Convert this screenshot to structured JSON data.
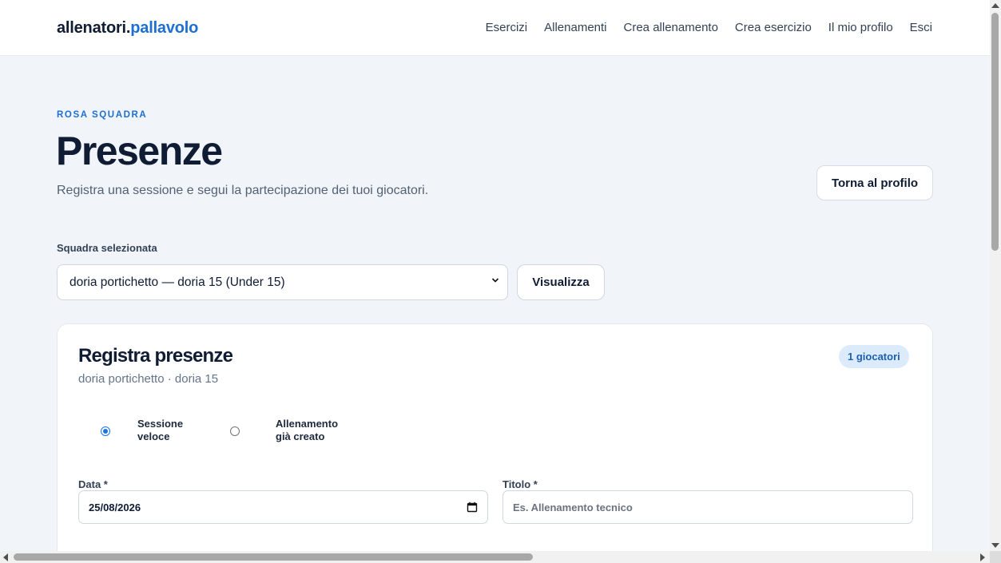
{
  "header": {
    "brand_part1": "allenatori.",
    "brand_part2": "pallavolo",
    "nav": [
      "Esercizi",
      "Allenamenti",
      "Crea allenamento",
      "Crea esercizio",
      "Il mio profilo",
      "Esci"
    ]
  },
  "hero": {
    "eyebrow": "ROSA SQUADRA",
    "title": "Presenze",
    "subtitle": "Registra una sessione e segui la partecipazione dei tuoi giocatori.",
    "back_button": "Torna al profilo"
  },
  "team": {
    "label": "Squadra selezionata",
    "selected": "doria portichetto — doria 15 (Under 15)",
    "view_button": "Visualizza"
  },
  "card": {
    "title": "Registra presenze",
    "subtitle": "doria portichetto · doria 15",
    "badge": "1 giocatori",
    "mode_options": [
      {
        "line1": "Sessione",
        "line2": "veloce",
        "checked": true
      },
      {
        "line1": "Allenamento",
        "line2": "già creato",
        "checked": false
      }
    ],
    "date_label": "Data *",
    "date_value": "25/08/2026",
    "title_label": "Titolo *",
    "title_placeholder": "Es. Allenamento tecnico"
  },
  "colors": {
    "accent": "#1d6fd1",
    "text_dark": "#0f1c33",
    "background": "#f1f5fa"
  },
  "icons": {
    "select": "chevron-down-icon",
    "date": "calendar-icon"
  }
}
